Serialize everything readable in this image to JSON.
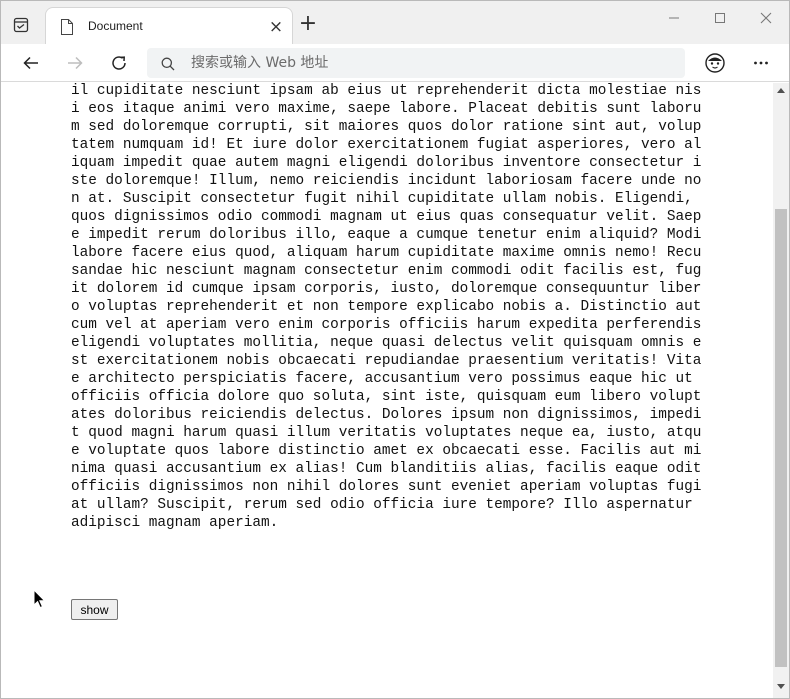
{
  "tab": {
    "title": "Document",
    "close_glyph": "×",
    "new_tab_glyph": "+"
  },
  "toolbar": {
    "address_placeholder": "搜索或输入 Web 地址",
    "more_glyph": "···"
  },
  "content": {
    "paragraph": "il cupiditate nesciunt ipsam ab eius ut reprehenderit dicta molestiae nisi eos itaque animi vero maxime, saepe labore. Placeat debitis sunt laborum sed doloremque corrupti, sit maiores quos dolor ratione sint aut, voluptatem numquam id! Et iure dolor exercitationem fugiat asperiores, vero aliquam impedit quae autem magni eligendi doloribus inventore consectetur iste doloremque! Illum, nemo reiciendis incidunt laboriosam facere unde non at. Suscipit consectetur fugit nihil cupiditate ullam nobis. Eligendi, quos dignissimos odio commodi magnam ut eius quas consequatur velit. Saepe impedit rerum doloribus illo, eaque a cumque tenetur enim aliquid? Modi labore facere eius quod, aliquam harum cupiditate maxime omnis nemo! Recusandae hic nesciunt magnam consectetur enim commodi odit facilis est, fugit dolorem id cumque ipsam corporis, iusto, doloremque consequuntur libero voluptas reprehenderit et non tempore explicabo nobis a. Distinctio aut cum vel at aperiam vero enim corporis officiis harum expedita perferendis eligendi voluptates mollitia, neque quasi delectus velit quisquam omnis est exercitationem nobis obcaecati repudiandae praesentium veritatis! Vitae architecto perspiciatis facere, accusantium vero possimus eaque hic ut officiis officia dolore quo soluta, sint iste, quisquam eum libero voluptates doloribus reiciendis delectus. Dolores ipsum non dignissimos, impedit quod magni harum quasi illum veritatis voluptates neque ea, iusto, atque voluptate quos labore distinctio amet ex obcaecati esse. Facilis aut minima quasi accusantium ex alias! Cum blanditiis alias, facilis eaque odit officiis dignissimos non nihil dolores sunt eveniet aperiam voluptas fugiat ullam? Suscipit, rerum sed odio officia iure tempore? Illo aspernatur adipisci magnam aperiam.",
    "show_button_label": "show"
  },
  "colors": {
    "tabstrip_bg": "#f0f0f0",
    "address_bg": "#f1f3f4",
    "scrollbar_thumb": "#c1c1c1"
  }
}
